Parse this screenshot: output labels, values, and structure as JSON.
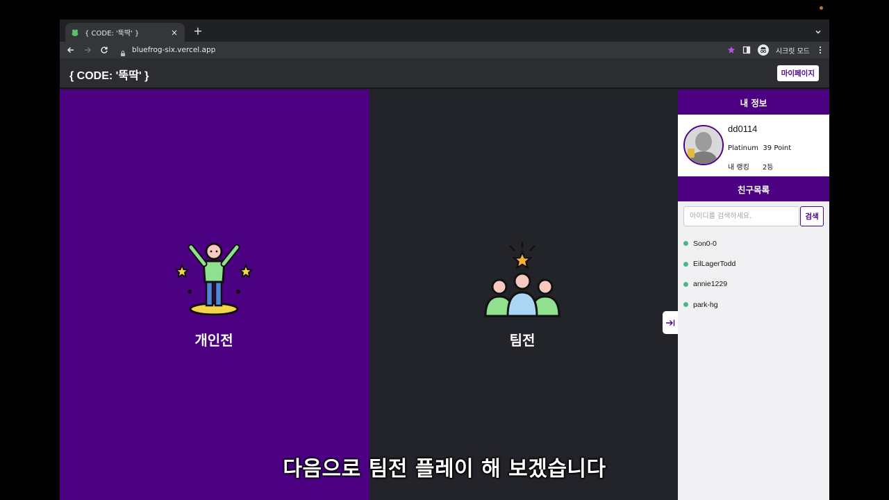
{
  "browser": {
    "tab_title": "{ CODE: '뚝딱' }",
    "tab_close": "×",
    "new_tab": "+",
    "url": "bluefrog-six.vercel.app",
    "incognito_label": "시크릿 모드"
  },
  "header": {
    "logo": "{ CODE: '뚝딱' }",
    "mypage_label": "마이페이지"
  },
  "modes": {
    "solo_label": "개인전",
    "team_label": "팀전"
  },
  "sidebar": {
    "my_info_title": "내 정보",
    "username": "dd0114",
    "tier_line": "Platinum  39 Point",
    "rank_line": "내 랭킹      2등",
    "friends_title": "친구목록",
    "search_placeholder": "아이디를 검색하세요.",
    "search_button": "검색",
    "friends": [
      {
        "name": "Son0-0",
        "status": "online"
      },
      {
        "name": "EilLagerTodd",
        "status": "online"
      },
      {
        "name": "annie1229",
        "status": "online"
      },
      {
        "name": "park-hg",
        "status": "online"
      }
    ]
  },
  "subtitle": "다음으로 팀전 플레이 해 보겠습니다",
  "colors": {
    "brand_purple": "#4b0181",
    "dark_pane": "#232429",
    "online_green": "#49b88e"
  }
}
